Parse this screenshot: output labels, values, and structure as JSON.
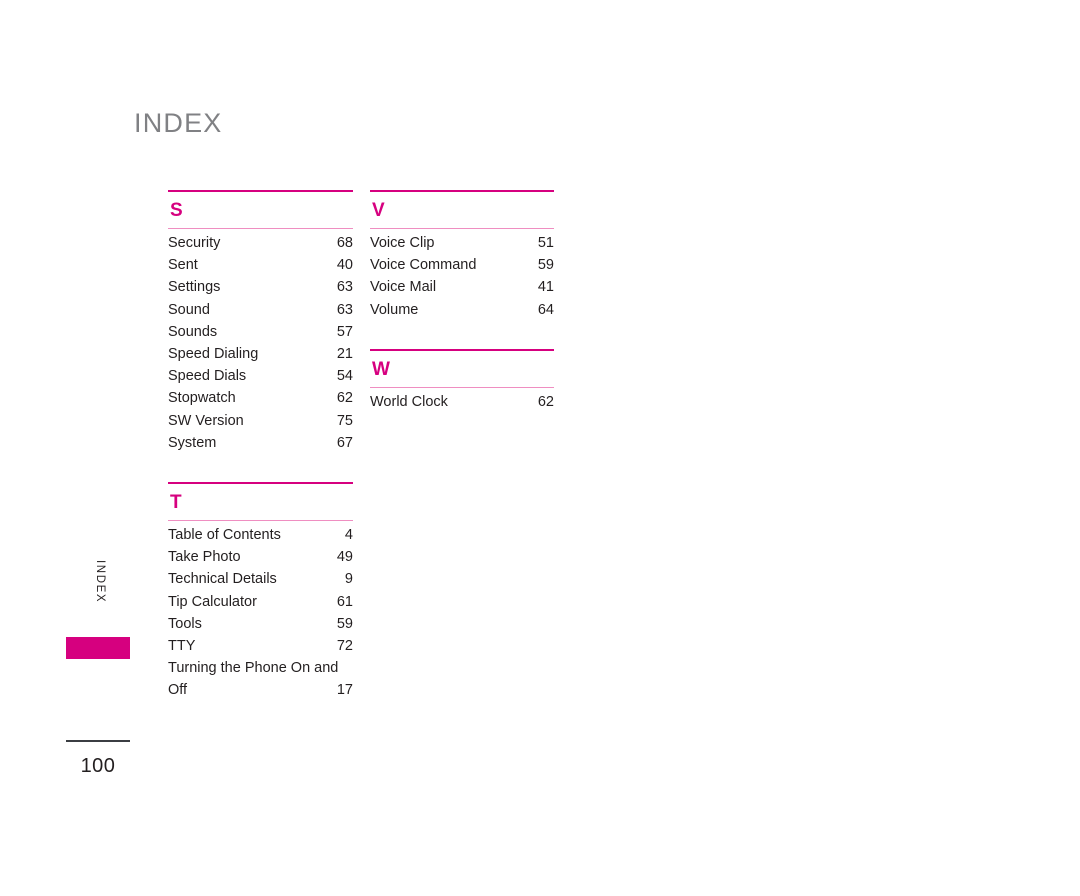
{
  "page": {
    "title": "INDEX",
    "side_tab_label": "INDEX",
    "page_number": "100",
    "colors": {
      "magenta": "#d6007f",
      "light_pink_rule": "#ef8ec1",
      "title_gray": "#808184",
      "text_black": "#231f20"
    }
  },
  "columns": [
    {
      "sections": [
        {
          "letter": "S",
          "entries": [
            {
              "label": "Security",
              "page": "68"
            },
            {
              "label": "Sent",
              "page": "40"
            },
            {
              "label": "Settings",
              "page": "63"
            },
            {
              "label": "Sound",
              "page": "63"
            },
            {
              "label": "Sounds",
              "page": "57"
            },
            {
              "label": "Speed Dialing",
              "page": "21"
            },
            {
              "label": "Speed Dials",
              "page": "54"
            },
            {
              "label": "Stopwatch",
              "page": "62"
            },
            {
              "label": "SW Version",
              "page": "75"
            },
            {
              "label": "System",
              "page": "67"
            }
          ]
        },
        {
          "letter": "T",
          "entries": [
            {
              "label": "Table of Contents",
              "page": "4"
            },
            {
              "label": "Take Photo",
              "page": "49"
            },
            {
              "label": "Technical Details",
              "page": "9"
            },
            {
              "label": "Tip Calculator",
              "page": "61"
            },
            {
              "label": "Tools",
              "page": "59"
            },
            {
              "label": "TTY",
              "page": "72"
            },
            {
              "label": "Turning the Phone On and Off",
              "page": "17",
              "wrap": true,
              "line1": "Turning the Phone On and",
              "line2": "Off"
            }
          ]
        }
      ]
    },
    {
      "sections": [
        {
          "letter": "V",
          "entries": [
            {
              "label": "Voice Clip",
              "page": "51"
            },
            {
              "label": "Voice Command",
              "page": "59"
            },
            {
              "label": "Voice Mail",
              "page": "41"
            },
            {
              "label": "Volume",
              "page": "64"
            }
          ]
        },
        {
          "letter": "W",
          "entries": [
            {
              "label": "World Clock",
              "page": "62"
            }
          ]
        }
      ]
    }
  ]
}
